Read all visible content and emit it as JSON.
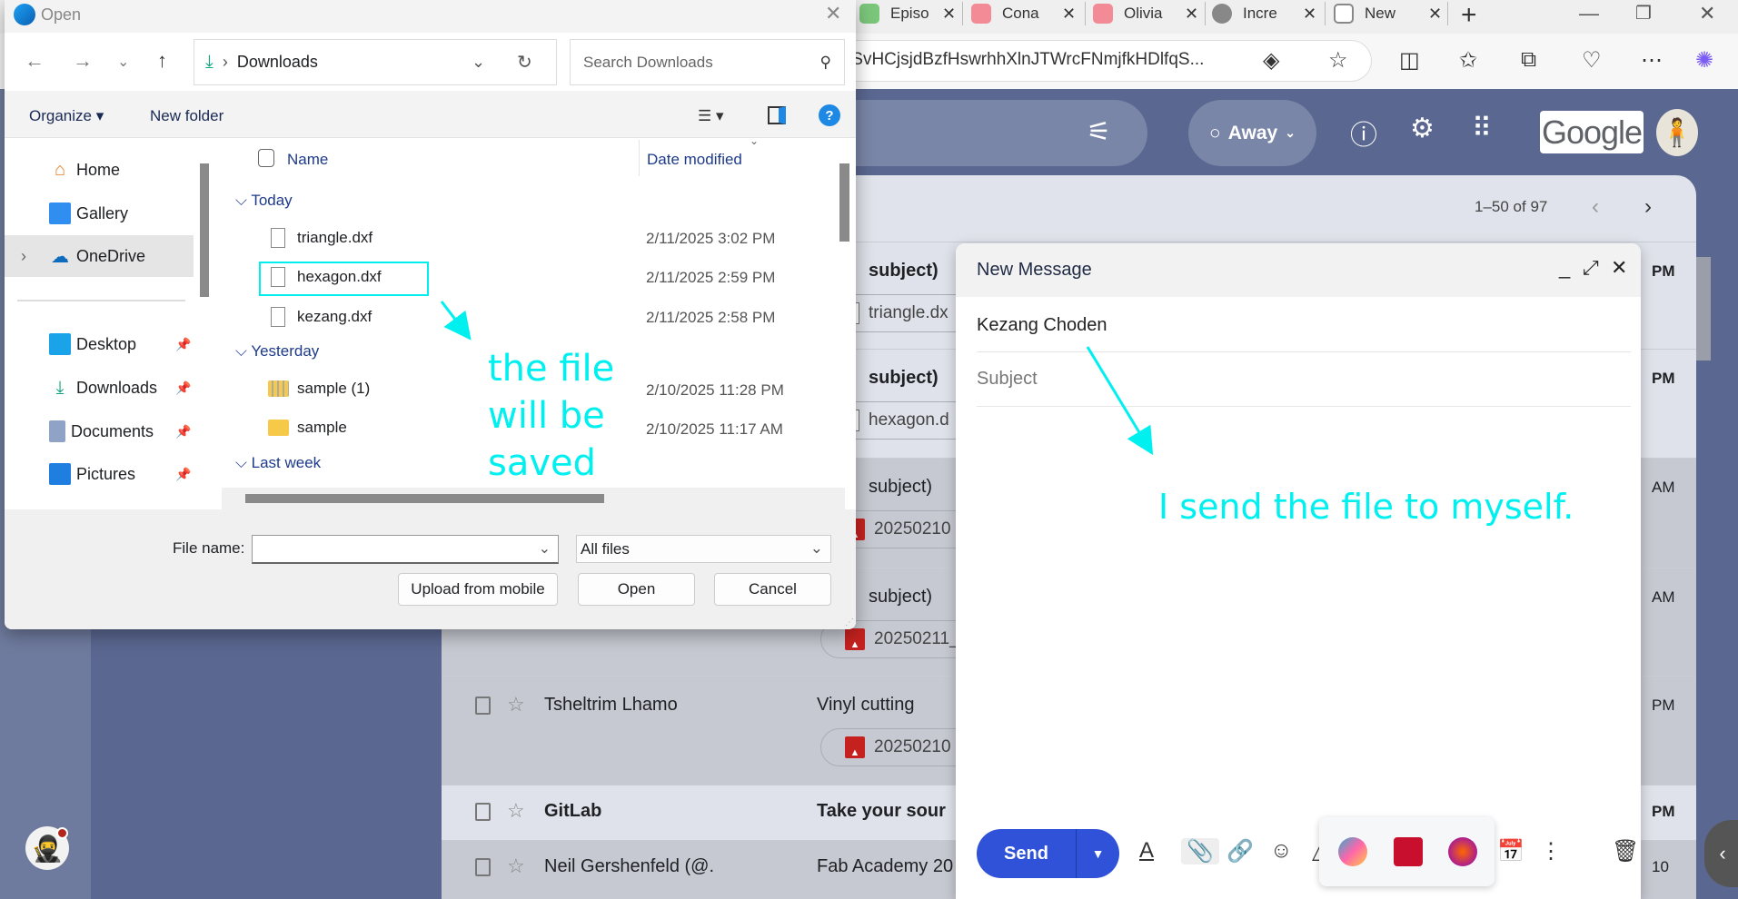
{
  "browser": {
    "tabs": [
      {
        "label": "Episo",
        "icon": "episode-favicon"
      },
      {
        "label": "Cona",
        "icon": "youtube-icon"
      },
      {
        "label": "Olivia",
        "icon": "youtube-icon"
      },
      {
        "label": "Incre",
        "icon": "chatgpt-icon"
      },
      {
        "label": "New",
        "icon": "new-tab-icon"
      }
    ],
    "url": ":SvHCjsjdBzfHswrhhXlnJTWrcFNmjfkHDlfqS..."
  },
  "gmail": {
    "status": "Away",
    "logo": "Google",
    "pagination": "1–50 of 97",
    "emails": [
      {
        "sender": "",
        "subject": "subject)",
        "attachment": "triangle.dx",
        "attachment_type": "file",
        "time": "PM",
        "unread": true
      },
      {
        "sender": "",
        "subject": "subject)",
        "attachment": "hexagon.d",
        "attachment_type": "file",
        "time": "PM",
        "unread": true
      },
      {
        "sender": "",
        "subject": "subject)",
        "attachment": "20250210",
        "attachment_type": "image",
        "time": "AM",
        "unread": false
      },
      {
        "sender": "",
        "subject": "subject)",
        "attachment": "20250211_",
        "attachment_type": "image",
        "time": "AM",
        "unread": false
      },
      {
        "sender": "Tsheltrim Lhamo",
        "subject": "Vinyl cutting",
        "attachment": "20250210",
        "attachment_type": "image",
        "time": "PM",
        "unread": false
      },
      {
        "sender": "GitLab",
        "subject": "Take your sour",
        "time": "PM",
        "unread": true
      },
      {
        "sender": "Neil Gershenfeld (@.",
        "subject": "Fab Academy 20",
        "time": "10",
        "unread": false
      }
    ]
  },
  "compose": {
    "title": "New Message",
    "to": "Kezang Choden",
    "subject_placeholder": "Subject",
    "send_label": "Send"
  },
  "dialog": {
    "title": "Open",
    "path": "Downloads",
    "search_placeholder": "Search Downloads",
    "organize": "Organize",
    "new_folder": "New folder",
    "nav": [
      {
        "label": "Home",
        "icon": "home-icon"
      },
      {
        "label": "Gallery",
        "icon": "gallery-icon"
      },
      {
        "label": "OneDrive",
        "icon": "onedrive-icon",
        "selected": true
      },
      {
        "label": "Desktop",
        "icon": "desktop-icon",
        "pinned": true
      },
      {
        "label": "Downloads",
        "icon": "downloads-icon",
        "pinned": true
      },
      {
        "label": "Documents",
        "icon": "documents-icon",
        "pinned": true
      },
      {
        "label": "Pictures",
        "icon": "pictures-icon",
        "pinned": true
      }
    ],
    "columns": {
      "name": "Name",
      "date": "Date modified"
    },
    "groups": {
      "today": "Today",
      "yesterday": "Yesterday",
      "last_week": "Last week"
    },
    "files": [
      {
        "name": "triangle.dxf",
        "date": "2/11/2025 3:02 PM",
        "type": "file"
      },
      {
        "name": "hexagon.dxf",
        "date": "2/11/2025 2:59 PM",
        "type": "file"
      },
      {
        "name": "kezang.dxf",
        "date": "2/11/2025 2:58 PM",
        "type": "file"
      },
      {
        "name": "sample (1)",
        "date": "2/10/2025 11:28 PM",
        "type": "zip-folder"
      },
      {
        "name": "sample",
        "date": "2/10/2025 11:17 AM",
        "type": "folder"
      }
    ],
    "file_name_label": "File name:",
    "file_name_value": "",
    "filter": "All files",
    "buttons": {
      "upload": "Upload from mobile",
      "open": "Open",
      "cancel": "Cancel"
    }
  },
  "annotations": {
    "dialog_note": "the file will be saved",
    "compose_note": "I send the file to myself.",
    "color": "#00f0f0"
  },
  "colors": {
    "gmail_bg": "#5a6790",
    "send_button": "#2f52d8",
    "accent": "#1e3a8a"
  }
}
